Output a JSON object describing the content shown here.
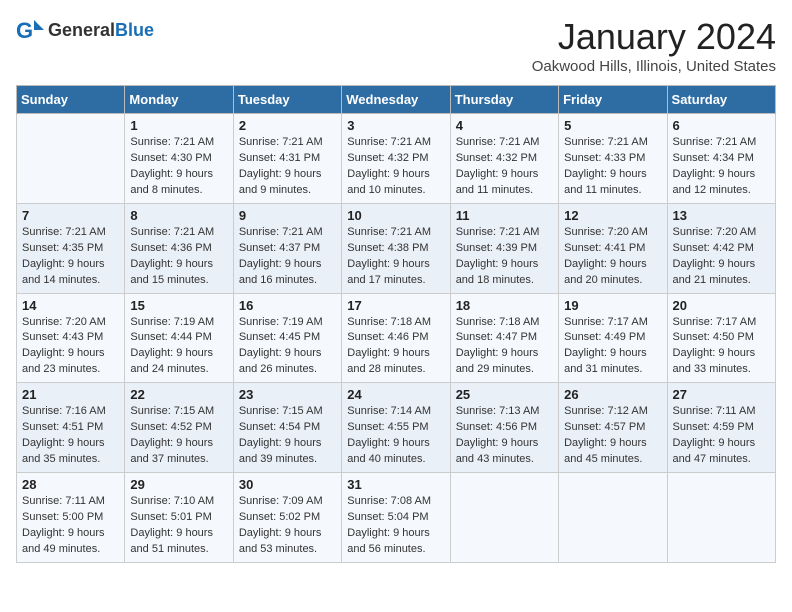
{
  "header": {
    "logo_general": "General",
    "logo_blue": "Blue",
    "month_title": "January 2024",
    "location": "Oakwood Hills, Illinois, United States"
  },
  "days_of_week": [
    "Sunday",
    "Monday",
    "Tuesday",
    "Wednesday",
    "Thursday",
    "Friday",
    "Saturday"
  ],
  "weeks": [
    [
      {
        "day": "",
        "info": ""
      },
      {
        "day": "1",
        "info": "Sunrise: 7:21 AM\nSunset: 4:30 PM\nDaylight: 9 hours\nand 8 minutes."
      },
      {
        "day": "2",
        "info": "Sunrise: 7:21 AM\nSunset: 4:31 PM\nDaylight: 9 hours\nand 9 minutes."
      },
      {
        "day": "3",
        "info": "Sunrise: 7:21 AM\nSunset: 4:32 PM\nDaylight: 9 hours\nand 10 minutes."
      },
      {
        "day": "4",
        "info": "Sunrise: 7:21 AM\nSunset: 4:32 PM\nDaylight: 9 hours\nand 11 minutes."
      },
      {
        "day": "5",
        "info": "Sunrise: 7:21 AM\nSunset: 4:33 PM\nDaylight: 9 hours\nand 11 minutes."
      },
      {
        "day": "6",
        "info": "Sunrise: 7:21 AM\nSunset: 4:34 PM\nDaylight: 9 hours\nand 12 minutes."
      }
    ],
    [
      {
        "day": "7",
        "info": "Sunrise: 7:21 AM\nSunset: 4:35 PM\nDaylight: 9 hours\nand 14 minutes."
      },
      {
        "day": "8",
        "info": "Sunrise: 7:21 AM\nSunset: 4:36 PM\nDaylight: 9 hours\nand 15 minutes."
      },
      {
        "day": "9",
        "info": "Sunrise: 7:21 AM\nSunset: 4:37 PM\nDaylight: 9 hours\nand 16 minutes."
      },
      {
        "day": "10",
        "info": "Sunrise: 7:21 AM\nSunset: 4:38 PM\nDaylight: 9 hours\nand 17 minutes."
      },
      {
        "day": "11",
        "info": "Sunrise: 7:21 AM\nSunset: 4:39 PM\nDaylight: 9 hours\nand 18 minutes."
      },
      {
        "day": "12",
        "info": "Sunrise: 7:20 AM\nSunset: 4:41 PM\nDaylight: 9 hours\nand 20 minutes."
      },
      {
        "day": "13",
        "info": "Sunrise: 7:20 AM\nSunset: 4:42 PM\nDaylight: 9 hours\nand 21 minutes."
      }
    ],
    [
      {
        "day": "14",
        "info": "Sunrise: 7:20 AM\nSunset: 4:43 PM\nDaylight: 9 hours\nand 23 minutes."
      },
      {
        "day": "15",
        "info": "Sunrise: 7:19 AM\nSunset: 4:44 PM\nDaylight: 9 hours\nand 24 minutes."
      },
      {
        "day": "16",
        "info": "Sunrise: 7:19 AM\nSunset: 4:45 PM\nDaylight: 9 hours\nand 26 minutes."
      },
      {
        "day": "17",
        "info": "Sunrise: 7:18 AM\nSunset: 4:46 PM\nDaylight: 9 hours\nand 28 minutes."
      },
      {
        "day": "18",
        "info": "Sunrise: 7:18 AM\nSunset: 4:47 PM\nDaylight: 9 hours\nand 29 minutes."
      },
      {
        "day": "19",
        "info": "Sunrise: 7:17 AM\nSunset: 4:49 PM\nDaylight: 9 hours\nand 31 minutes."
      },
      {
        "day": "20",
        "info": "Sunrise: 7:17 AM\nSunset: 4:50 PM\nDaylight: 9 hours\nand 33 minutes."
      }
    ],
    [
      {
        "day": "21",
        "info": "Sunrise: 7:16 AM\nSunset: 4:51 PM\nDaylight: 9 hours\nand 35 minutes."
      },
      {
        "day": "22",
        "info": "Sunrise: 7:15 AM\nSunset: 4:52 PM\nDaylight: 9 hours\nand 37 minutes."
      },
      {
        "day": "23",
        "info": "Sunrise: 7:15 AM\nSunset: 4:54 PM\nDaylight: 9 hours\nand 39 minutes."
      },
      {
        "day": "24",
        "info": "Sunrise: 7:14 AM\nSunset: 4:55 PM\nDaylight: 9 hours\nand 40 minutes."
      },
      {
        "day": "25",
        "info": "Sunrise: 7:13 AM\nSunset: 4:56 PM\nDaylight: 9 hours\nand 43 minutes."
      },
      {
        "day": "26",
        "info": "Sunrise: 7:12 AM\nSunset: 4:57 PM\nDaylight: 9 hours\nand 45 minutes."
      },
      {
        "day": "27",
        "info": "Sunrise: 7:11 AM\nSunset: 4:59 PM\nDaylight: 9 hours\nand 47 minutes."
      }
    ],
    [
      {
        "day": "28",
        "info": "Sunrise: 7:11 AM\nSunset: 5:00 PM\nDaylight: 9 hours\nand 49 minutes."
      },
      {
        "day": "29",
        "info": "Sunrise: 7:10 AM\nSunset: 5:01 PM\nDaylight: 9 hours\nand 51 minutes."
      },
      {
        "day": "30",
        "info": "Sunrise: 7:09 AM\nSunset: 5:02 PM\nDaylight: 9 hours\nand 53 minutes."
      },
      {
        "day": "31",
        "info": "Sunrise: 7:08 AM\nSunset: 5:04 PM\nDaylight: 9 hours\nand 56 minutes."
      },
      {
        "day": "",
        "info": ""
      },
      {
        "day": "",
        "info": ""
      },
      {
        "day": "",
        "info": ""
      }
    ]
  ]
}
